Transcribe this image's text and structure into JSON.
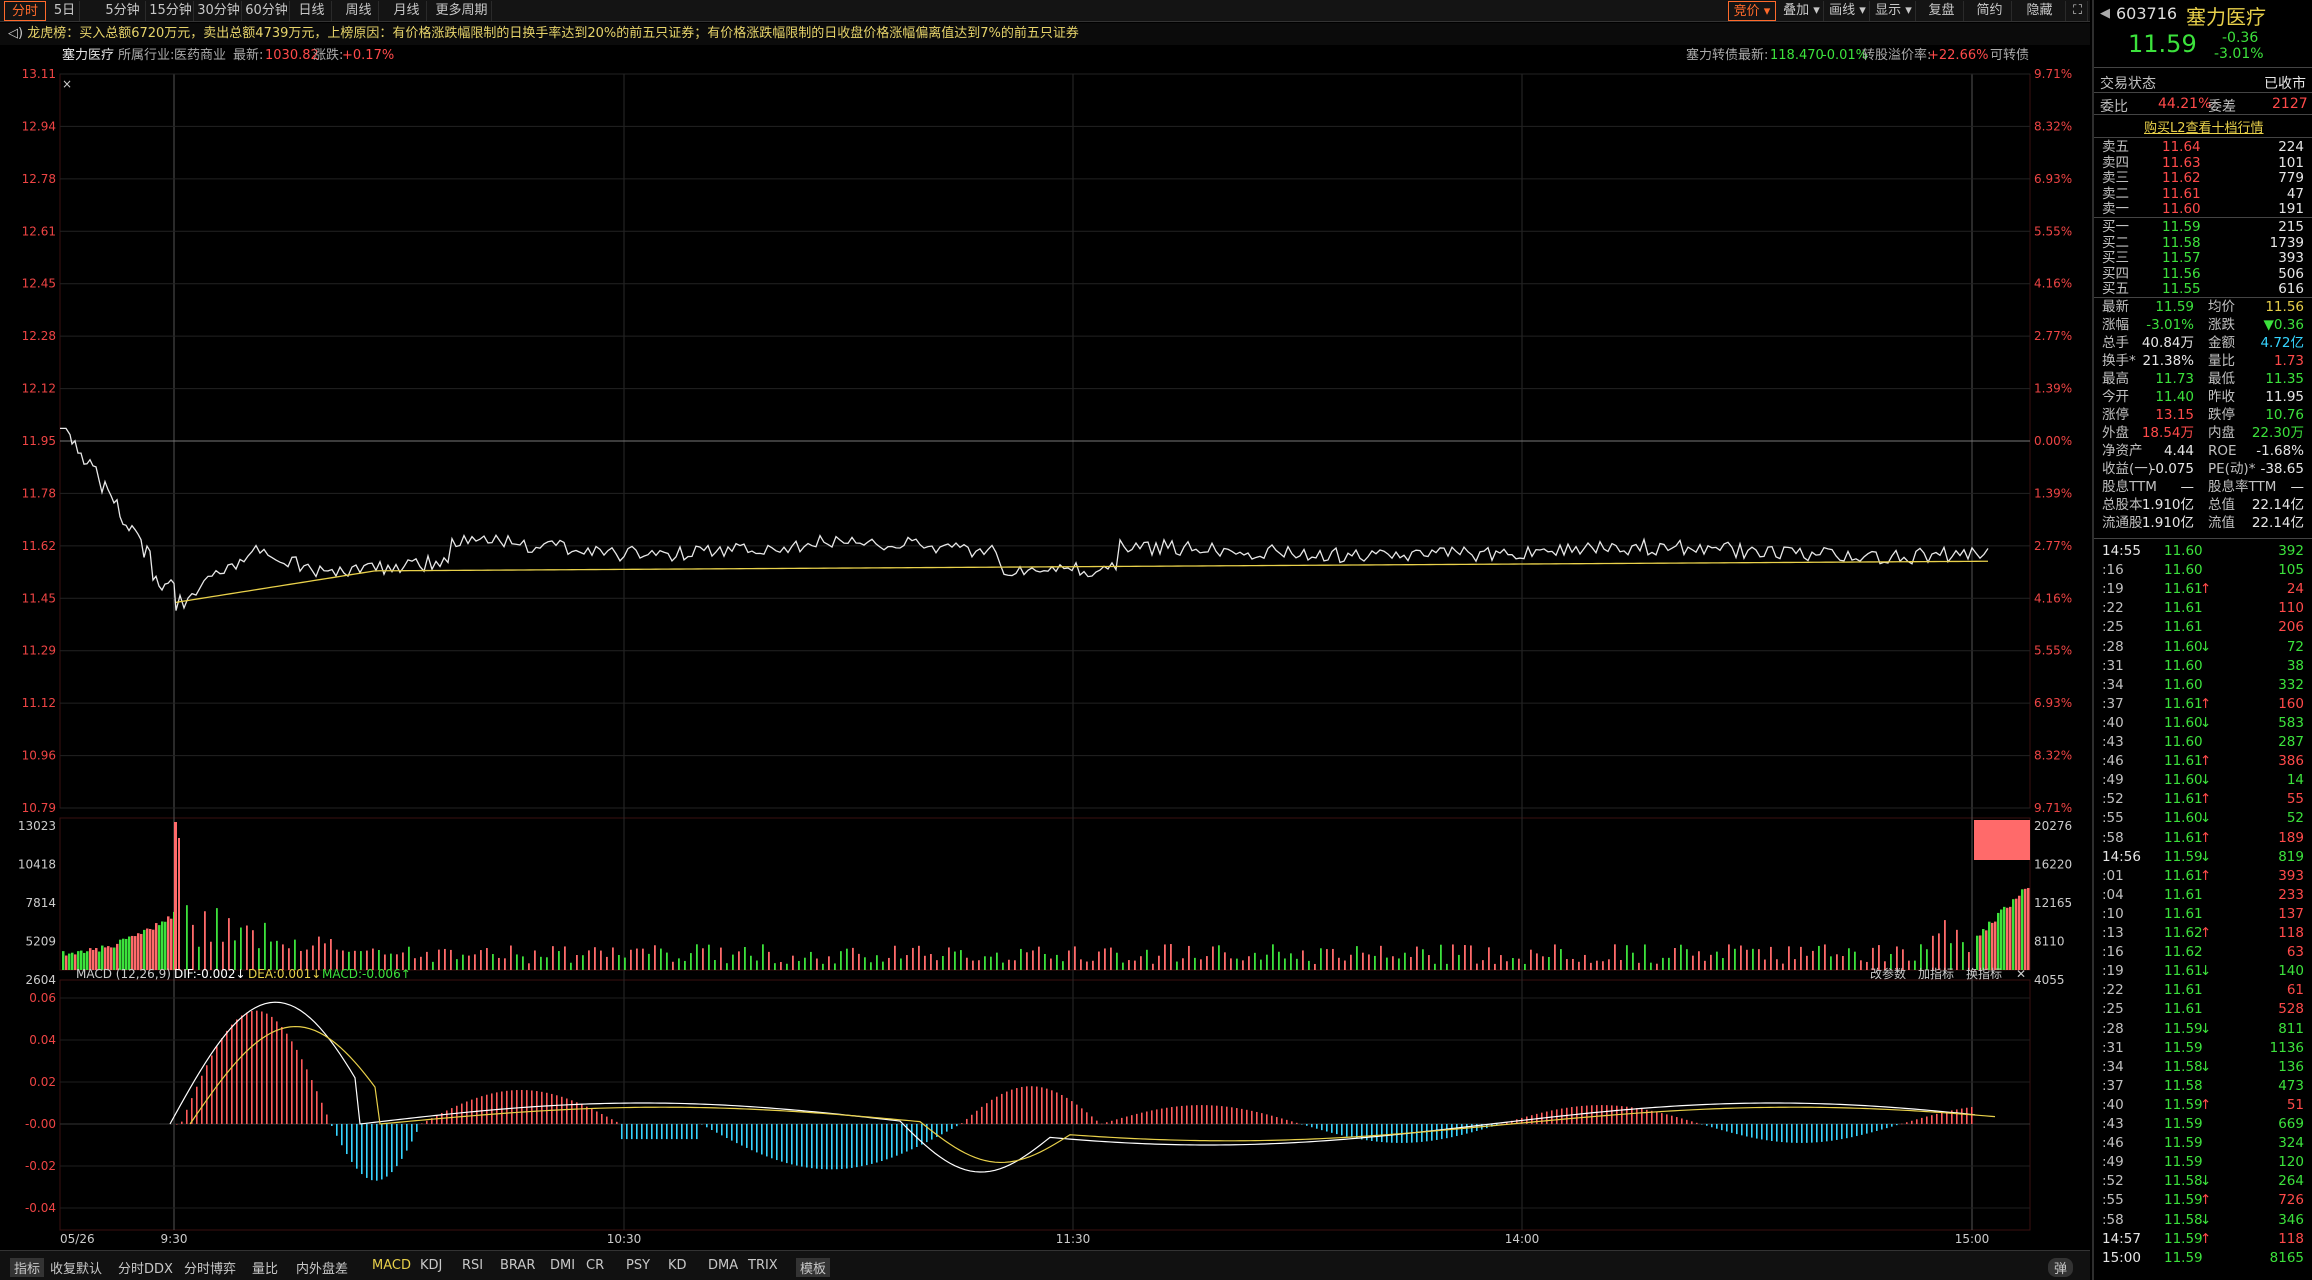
{
  "toolbar": {
    "items": [
      "分时",
      "5日",
      "5分钟",
      "15分钟",
      "30分钟",
      "60分钟",
      "日线",
      "周线",
      "月线",
      "更多周期"
    ],
    "right_items": [
      "竞价",
      "叠加",
      "画线",
      "显示",
      "复盘",
      "简约",
      "隐藏"
    ]
  },
  "news": "龙虎榜：买入总额6720万元，卖出总额4739万元，上榜原因：有价格涨跌幅限制的日换手率达到20%的前五只证券；有价格涨跌幅限制的日收盘价格涨幅偏离值达到7%的前五只证券",
  "namebar": {
    "stock": "塞力医疗",
    "industry_label": "所属行业:",
    "industry": "医药商业",
    "latest_label": "最新:",
    "latest": "1030.82",
    "change_label": "涨跌:",
    "change": "+0.17%",
    "convert_label": "塞力转债最新:",
    "convert_price": "118.470",
    "convert_pct": "-0.01%",
    "premium_label": "转股溢价率:",
    "premium": "+22.66%",
    "bond_link": "可转债"
  },
  "chart_data": {
    "type": "line",
    "price_axis_left": [
      "13.11",
      "12.94",
      "12.78",
      "12.61",
      "12.45",
      "12.28",
      "12.12",
      "11.95",
      "11.78",
      "11.62",
      "11.45",
      "11.29",
      "11.12",
      "10.96",
      "10.79"
    ],
    "price_axis_right": [
      "9.71%",
      "8.32%",
      "6.93%",
      "5.55%",
      "4.16%",
      "2.77%",
      "1.39%",
      "0.00%",
      "1.39%",
      "2.77%",
      "4.16%",
      "5.55%",
      "6.93%",
      "8.32%",
      "9.71%"
    ],
    "ylim": [
      10.79,
      13.11
    ],
    "prev_close": 11.95,
    "volume_axis_left": [
      "13023",
      "10418",
      "7814",
      "5209",
      "2604"
    ],
    "volume_axis_right": [
      "20276",
      "16220",
      "12165",
      "8110",
      "4055"
    ],
    "macd_axis": [
      "0.06",
      "0.04",
      "0.02",
      "-0.00",
      "-0.02",
      "-0.04"
    ],
    "time_labels": [
      "05/26",
      "9:30",
      "10:30",
      "11:30",
      "14:00",
      "15:00"
    ],
    "macd_label": "MACD (12,26,9)",
    "dif": "DIF:-0.002",
    "dea": "DEA:0.001",
    "macd": "MACD:-0.006",
    "macd_buttons": [
      "改参数",
      "加指标",
      "换指标"
    ]
  },
  "bottom": {
    "items": [
      "指标",
      "收复默认",
      "分时DDX",
      "分时博弈",
      "量比",
      "内外盘差",
      "MACD",
      "KDJ",
      "RSI",
      "BRAR",
      "DMI",
      "CR",
      "PSY",
      "KD",
      "DMA",
      "TRIX",
      "模板"
    ],
    "toggle": "弹"
  },
  "panel": {
    "code": "603716",
    "name": "塞力医疗",
    "price": "11.59",
    "chg": "-0.36",
    "pct": "-3.01%",
    "status_label": "交易状态",
    "status": "已收市",
    "weibi_label": "委比",
    "weibi": "44.21%",
    "weicha_label": "委差",
    "weicha": "2127",
    "l2": "购买L2查看十档行情",
    "sells": [
      [
        "卖五",
        "11.64",
        "224"
      ],
      [
        "卖四",
        "11.63",
        "101"
      ],
      [
        "卖三",
        "11.62",
        "779"
      ],
      [
        "卖二",
        "11.61",
        "47"
      ],
      [
        "卖一",
        "11.60",
        "191"
      ]
    ],
    "buys": [
      [
        "买一",
        "11.59",
        "215"
      ],
      [
        "买二",
        "11.58",
        "1739"
      ],
      [
        "买三",
        "11.57",
        "393"
      ],
      [
        "买四",
        "11.56",
        "506"
      ],
      [
        "买五",
        "11.55",
        "616"
      ]
    ],
    "stats": [
      [
        "最新",
        "11.59",
        "均价",
        "11.56"
      ],
      [
        "涨幅",
        "-3.01%",
        "涨跌",
        "▼0.36"
      ],
      [
        "总手",
        "40.84万",
        "金额",
        "4.72亿"
      ],
      [
        "换手*",
        "21.38%",
        "量比",
        "1.73"
      ],
      [
        "最高",
        "11.73",
        "最低",
        "11.35"
      ],
      [
        "今开",
        "11.40",
        "昨收",
        "11.95"
      ],
      [
        "涨停",
        "13.15",
        "跌停",
        "10.76"
      ],
      [
        "外盘",
        "18.54万",
        "内盘",
        "22.30万"
      ],
      [
        "净资产",
        "4.44",
        "ROE",
        "-1.68%"
      ],
      [
        "收益(一)",
        "-0.075",
        "PE(动)*",
        "-38.65"
      ],
      [
        "股息TTM",
        "—",
        "股息率TTM",
        "—"
      ],
      [
        "总股本",
        "1.910亿",
        "总值",
        "22.14亿"
      ],
      [
        "流通股",
        "1.910亿",
        "流值",
        "22.14亿"
      ]
    ],
    "ticks": [
      [
        "14:55",
        "11.60",
        "392",
        ""
      ],
      [
        ":16",
        "11.60",
        "105",
        ""
      ],
      [
        ":19",
        "11.61",
        "24",
        "↑"
      ],
      [
        ":22",
        "11.61",
        "110",
        ""
      ],
      [
        ":25",
        "11.61",
        "206",
        ""
      ],
      [
        ":28",
        "11.60",
        "72",
        "↓"
      ],
      [
        ":31",
        "11.60",
        "38",
        ""
      ],
      [
        ":34",
        "11.60",
        "332",
        ""
      ],
      [
        ":37",
        "11.61",
        "160",
        "↑"
      ],
      [
        ":40",
        "11.60",
        "583",
        "↓"
      ],
      [
        ":43",
        "11.60",
        "287",
        ""
      ],
      [
        ":46",
        "11.61",
        "386",
        "↑"
      ],
      [
        ":49",
        "11.60",
        "14",
        "↓"
      ],
      [
        ":52",
        "11.61",
        "55",
        "↑"
      ],
      [
        ":55",
        "11.60",
        "52",
        "↓"
      ],
      [
        ":58",
        "11.61",
        "189",
        "↑"
      ],
      [
        "14:56",
        "11.59",
        "819",
        "↓"
      ],
      [
        ":01",
        "11.61",
        "393",
        "↑"
      ],
      [
        ":04",
        "11.61",
        "233",
        ""
      ],
      [
        ":10",
        "11.61",
        "137",
        ""
      ],
      [
        ":13",
        "11.62",
        "118",
        "↑"
      ],
      [
        ":16",
        "11.62",
        "63",
        ""
      ],
      [
        ":19",
        "11.61",
        "140",
        "↓"
      ],
      [
        ":22",
        "11.61",
        "61",
        ""
      ],
      [
        ":25",
        "11.61",
        "528",
        ""
      ],
      [
        ":28",
        "11.59",
        "811",
        "↓"
      ],
      [
        ":31",
        "11.59",
        "1136",
        ""
      ],
      [
        ":34",
        "11.58",
        "136",
        "↓"
      ],
      [
        ":37",
        "11.58",
        "473",
        ""
      ],
      [
        ":40",
        "11.59",
        "51",
        "↑"
      ],
      [
        ":43",
        "11.59",
        "669",
        ""
      ],
      [
        ":46",
        "11.59",
        "324",
        ""
      ],
      [
        ":49",
        "11.59",
        "120",
        ""
      ],
      [
        ":52",
        "11.58",
        "264",
        "↓"
      ],
      [
        ":55",
        "11.59",
        "726",
        "↑"
      ],
      [
        ":58",
        "11.58",
        "346",
        "↓"
      ],
      [
        "14:57",
        "11.59",
        "118",
        "↑"
      ],
      [
        "15:00",
        "11.59",
        "8165",
        ""
      ]
    ]
  }
}
